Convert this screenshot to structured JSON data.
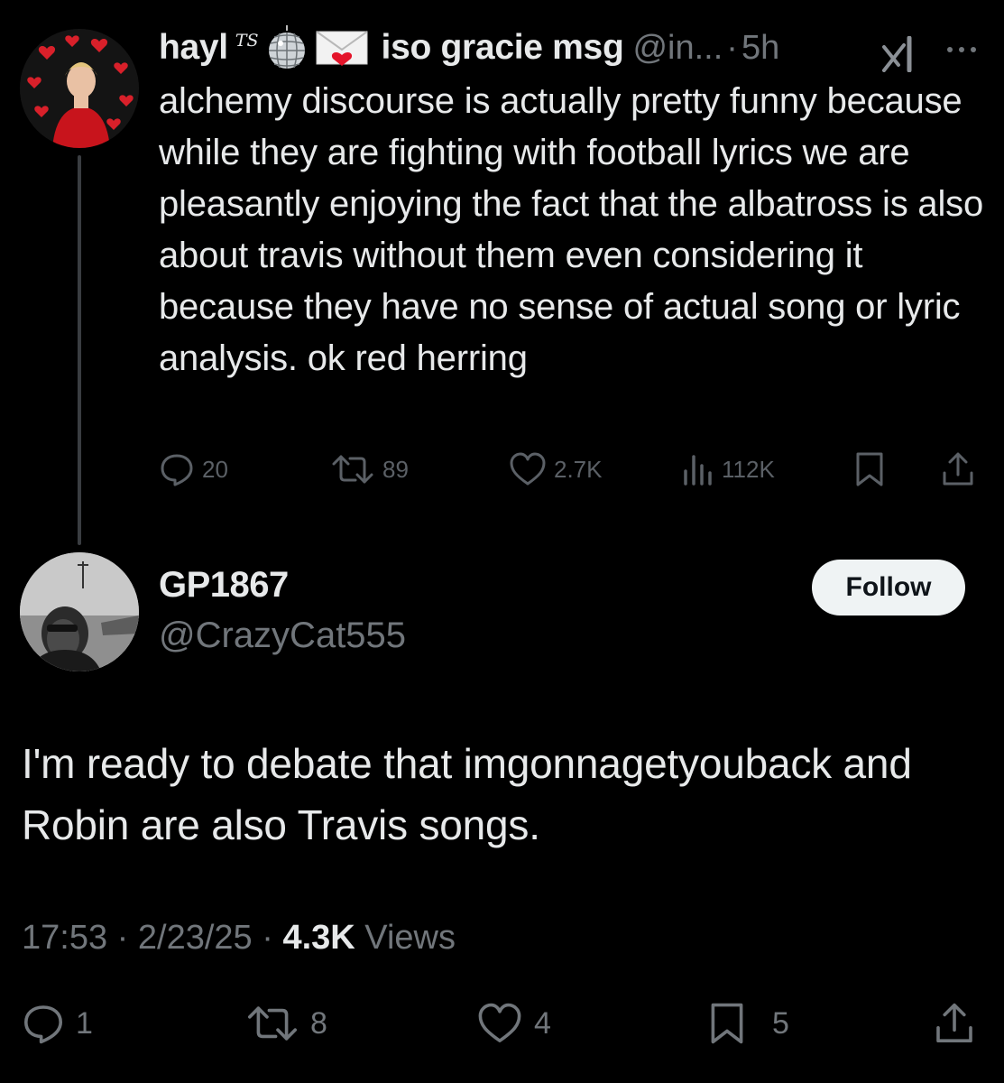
{
  "parent_tweet": {
    "display_name": "hayl",
    "ts_mark": "TS",
    "emojis": [
      "disco-ball-emoji",
      "love-letter-emoji"
    ],
    "display_name_suffix": "iso gracie msg",
    "handle": "@in...",
    "separator": "·",
    "time": "5h",
    "text": "alchemy discourse is actually pretty funny because while they are fighting with football lyrics we are pleasantly enjoying the fact that the albatross is also about travis without them even considering it because they have no sense of actual song or lyric analysis. ok red herring",
    "actions": {
      "replies": "20",
      "reposts": "89",
      "likes": "2.7K",
      "views": "112K"
    }
  },
  "reply_tweet": {
    "display_name": "GP1867",
    "handle": "@CrazyCat555",
    "follow_label": "Follow",
    "text": "I'm ready to debate that imgonnagetyouback and Robin are also Travis songs.",
    "time": "17:53",
    "separator": "·",
    "date": "2/23/25",
    "views_count": "4.3K",
    "views_label": "Views",
    "actions": {
      "replies": "1",
      "reposts": "8",
      "likes": "4",
      "bookmarks": "5"
    }
  },
  "colors": {
    "background": "#000000",
    "text_primary": "#e7e9ea",
    "text_secondary": "#71767b",
    "follow_button_bg": "#eff3f4",
    "thread_line": "#3a3d41"
  }
}
